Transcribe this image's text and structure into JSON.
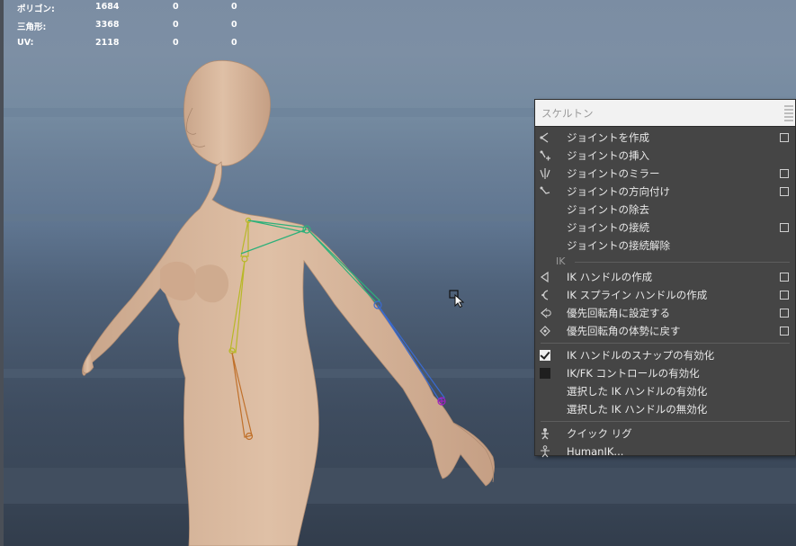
{
  "hud": {
    "rows": [
      {
        "label": "ポリゴン:",
        "v1": "1684",
        "v2": "0",
        "v3": "0"
      },
      {
        "label": "三角形:",
        "v1": "3368",
        "v2": "0",
        "v3": "0"
      },
      {
        "label": "UV:",
        "v1": "2118",
        "v2": "0",
        "v3": "0"
      }
    ]
  },
  "menu": {
    "title": "スケルトン",
    "items": [
      {
        "label": "ジョイントを作成",
        "icon": "joint-create-icon",
        "option": true
      },
      {
        "label": "ジョイントの挿入",
        "icon": "joint-insert-icon",
        "option": false
      },
      {
        "label": "ジョイントのミラー",
        "icon": "joint-mirror-icon",
        "option": true
      },
      {
        "label": "ジョイントの方向付け",
        "icon": "joint-orient-icon",
        "option": true
      },
      {
        "label": "ジョイントの除去",
        "icon": "",
        "option": false
      },
      {
        "label": "ジョイントの接続",
        "icon": "",
        "option": true
      },
      {
        "label": "ジョイントの接続解除",
        "icon": "",
        "option": false
      }
    ],
    "ik_section": "IK",
    "ik_items": [
      {
        "label": "IK ハンドルの作成",
        "icon": "ik-handle-icon",
        "option": true
      },
      {
        "label": "IK スプライン ハンドルの作成",
        "icon": "ik-spline-icon",
        "option": true
      },
      {
        "label": "優先回転角に設定する",
        "icon": "preferred-angle-set-icon",
        "option": true
      },
      {
        "label": "優先回転角の体勢に戻す",
        "icon": "preferred-angle-assume-icon",
        "option": true
      }
    ],
    "toggle_items": [
      {
        "label": "IK ハンドルのスナップの有効化",
        "checked": true
      },
      {
        "label": "IK/FK コントロールの有効化",
        "checked": false
      },
      {
        "label": "選択した IK ハンドルの有効化",
        "checked": null
      },
      {
        "label": "選択した IK ハンドルの無効化",
        "checked": null
      }
    ],
    "rig_items": [
      {
        "label": "クイック リグ",
        "icon": "quick-rig-icon"
      },
      {
        "label": "HumanIK...",
        "icon": "humanik-icon"
      }
    ]
  },
  "colors": {
    "skin": "#d9b89e",
    "bone_spine": "#b8b828",
    "bone_arm_upper": "#2eb07a",
    "bone_arm_lower": "#3a6ad0",
    "bone_leg": "#c0702a",
    "wrist": "#a020c0",
    "menu_bg": "#454545"
  }
}
